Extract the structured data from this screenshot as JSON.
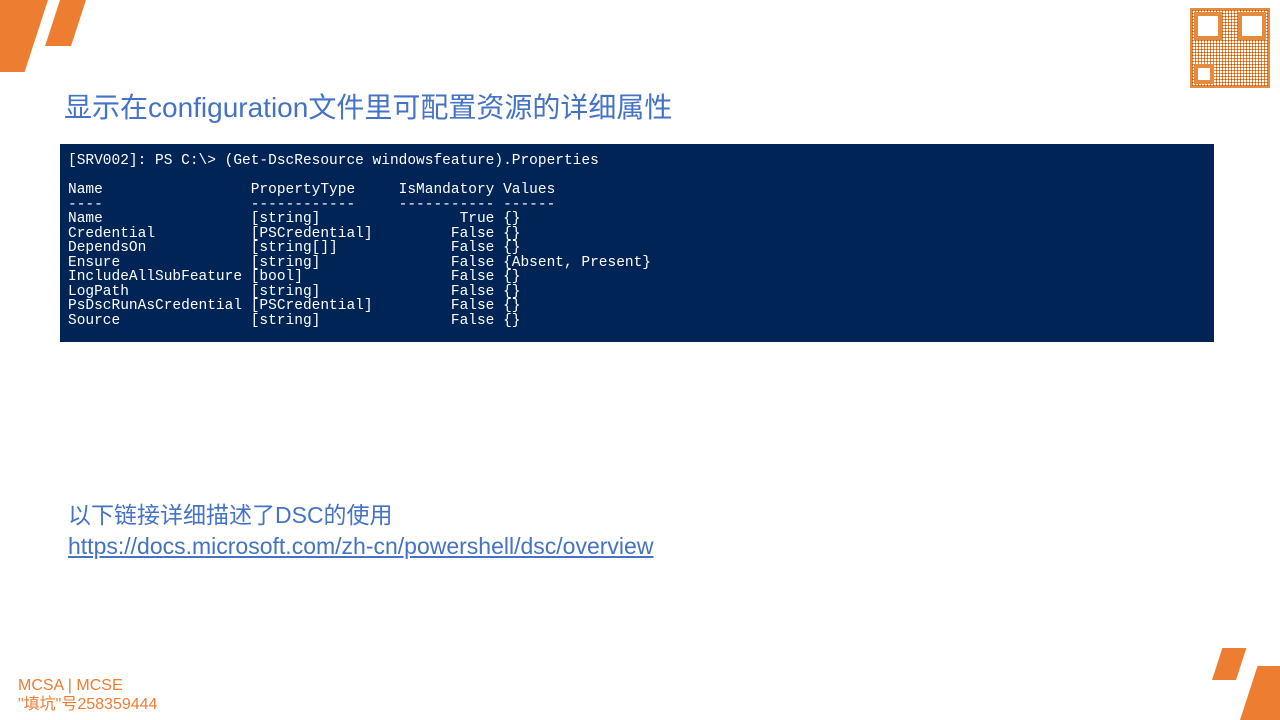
{
  "title": "显示在configuration文件里可配置资源的详细属性",
  "terminal": {
    "prompt": "[SRV002]: PS C:\\> (Get-DscResource windowsfeature).Properties",
    "headers": [
      "Name",
      "PropertyType",
      "IsMandatory",
      "Values"
    ],
    "rows": [
      {
        "name": "Name",
        "type": "[string]",
        "mandatory": "True",
        "values": "{}"
      },
      {
        "name": "Credential",
        "type": "[PSCredential]",
        "mandatory": "False",
        "values": "{}"
      },
      {
        "name": "DependsOn",
        "type": "[string[]]",
        "mandatory": "False",
        "values": "{}"
      },
      {
        "name": "Ensure",
        "type": "[string]",
        "mandatory": "False",
        "values": "{Absent, Present}"
      },
      {
        "name": "IncludeAllSubFeature",
        "type": "[bool]",
        "mandatory": "False",
        "values": "{}"
      },
      {
        "name": "LogPath",
        "type": "[string]",
        "mandatory": "False",
        "values": "{}"
      },
      {
        "name": "PsDscRunAsCredential",
        "type": "[PSCredential]",
        "mandatory": "False",
        "values": "{}"
      },
      {
        "name": "Source",
        "type": "[string]",
        "mandatory": "False",
        "values": "{}"
      }
    ]
  },
  "link_intro": "以下链接详细描述了DSC的使用",
  "link_url": "https://docs.microsoft.com/zh-cn/powershell/dsc/overview",
  "footer_line1": "MCSA | MCSE",
  "footer_line2": "\"填坑\"号258359444"
}
